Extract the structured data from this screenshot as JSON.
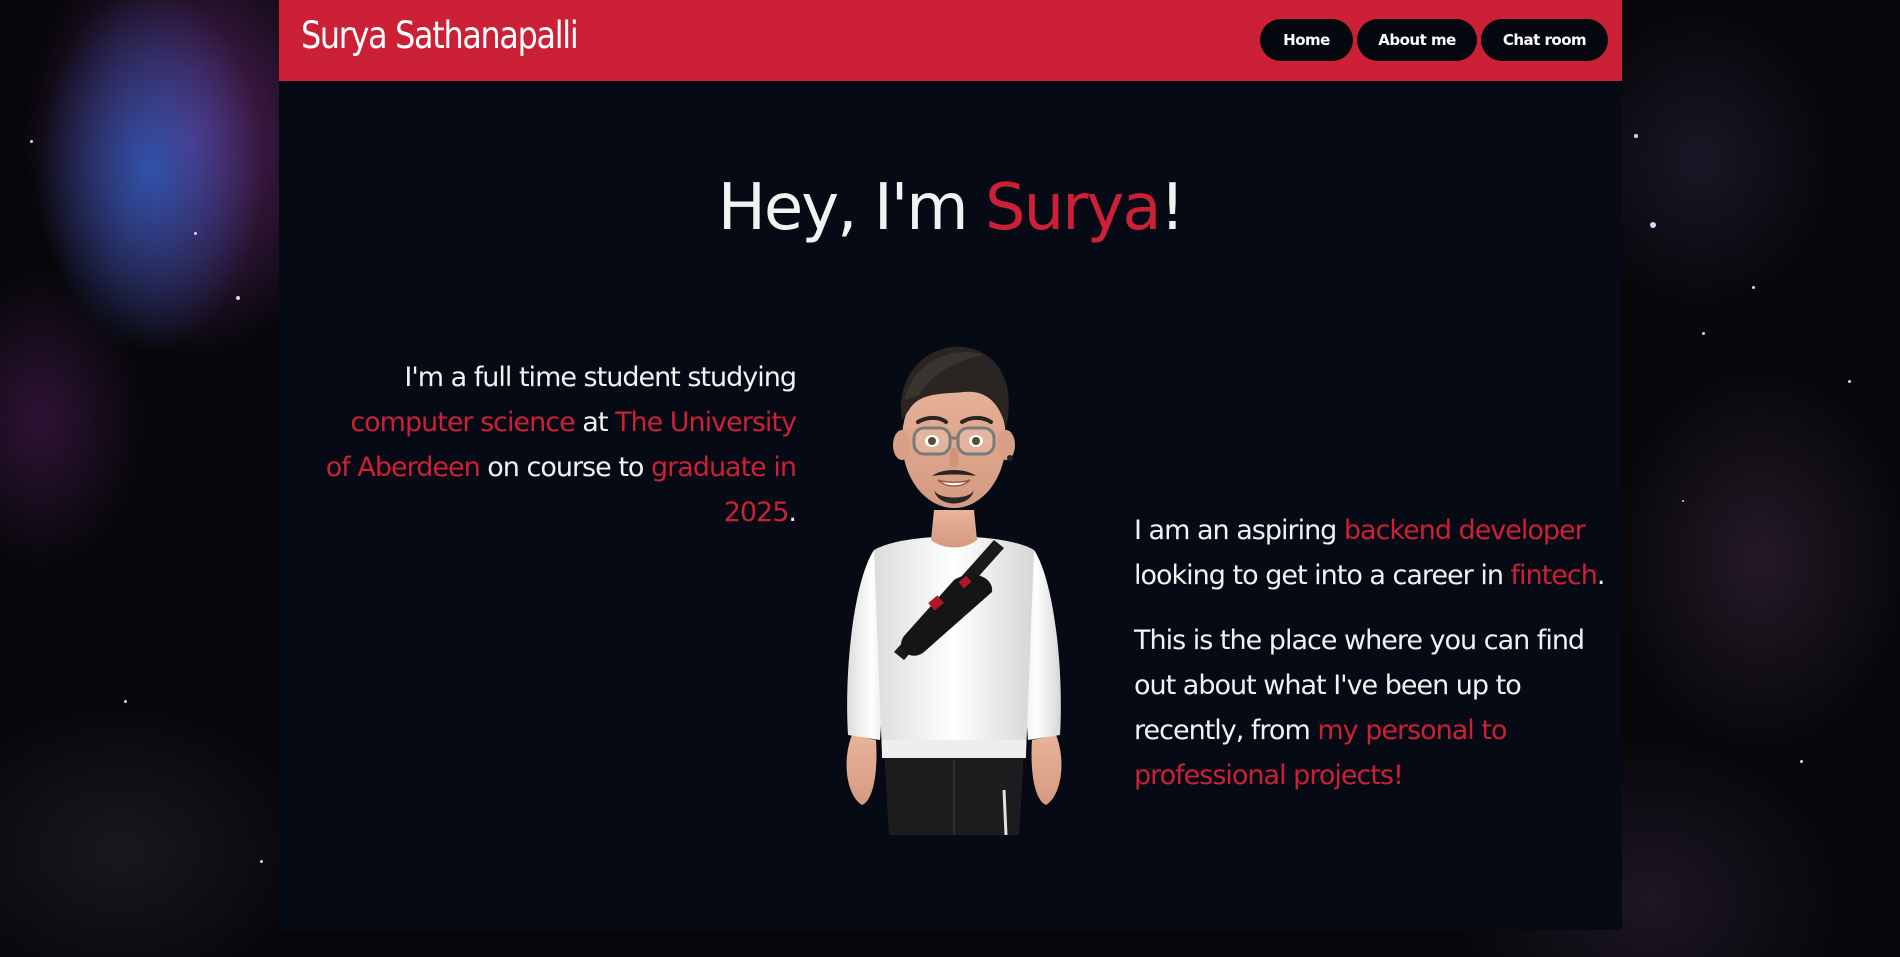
{
  "site": {
    "brand": "Surya Sathanapalli",
    "accent_color": "#cc2036",
    "panel_color": "#050a14"
  },
  "nav": {
    "items": [
      {
        "label": "Home"
      },
      {
        "label": "About me"
      },
      {
        "label": "Chat room"
      }
    ]
  },
  "hero": {
    "greeting_prefix": "Hey, I'm ",
    "name": "Surya",
    "greeting_suffix": "!"
  },
  "intro": {
    "t1": "I'm a full time student studying ",
    "h1": "computer science",
    "t2": " at ",
    "h2": "The University of Aberdeen",
    "t3": " on course to ",
    "h3": "graduate in 2025",
    "t4": "."
  },
  "career": {
    "t1": "I am an aspiring ",
    "h1": "backend developer",
    "t2": " looking to get into a career in ",
    "h2": "fintech",
    "t3": "."
  },
  "about": {
    "t1": "This is the place where you can find out about what I've been up to recently, from ",
    "h1": "my personal to professional projects!"
  },
  "avatar": {
    "icon": "memoji-avatar-illustration"
  }
}
